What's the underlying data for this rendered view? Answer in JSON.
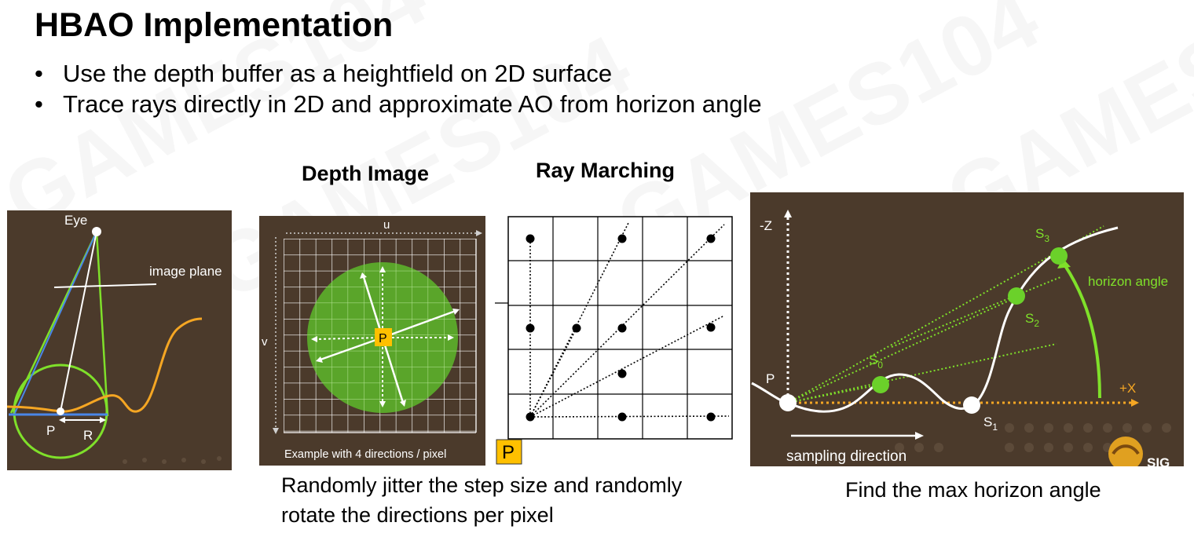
{
  "slide": {
    "title": "HBAO Implementation",
    "bullets": [
      "Use the depth buffer as a heightfield on 2D surface",
      "Trace rays directly in 2D and approximate AO from horizon angle"
    ],
    "watermark_text": "GAMES104"
  },
  "headings": {
    "depth_image": "Depth Image",
    "ray_marching": "Ray Marching"
  },
  "panel_eye": {
    "eye_label": "Eye",
    "image_plane_label": "image plane",
    "p_label": "P",
    "r_label": "R"
  },
  "panel_depth": {
    "u_label": "u",
    "v_label": "v",
    "p_label": "P",
    "example_label": "Example with 4 directions / pixel"
  },
  "panel_ray": {
    "p_badge": "P"
  },
  "panel_horizon": {
    "neg_z_label": "-Z",
    "plus_x_label": "+X",
    "p_label": "P",
    "s0": "S",
    "s0_sub": "0",
    "s1": "S",
    "s1_sub": "1",
    "s2": "S",
    "s2_sub": "2",
    "s3": "S",
    "s3_sub": "3",
    "horizon_angle_label": "horizon angle",
    "sampling_direction_label": "sampling direction",
    "logo_text": "SIG"
  },
  "captions": {
    "jitter_line1": "Randomly jitter the step size and randomly",
    "jitter_line2": "rotate the directions per pixel",
    "max_horizon": "Find the max horizon angle"
  },
  "colors": {
    "panel_brown": "#4b3a2b",
    "green": "#7fe02a",
    "orange": "#f5a623",
    "yellow_badge": "#ffc000",
    "blue": "#4a86e8"
  }
}
